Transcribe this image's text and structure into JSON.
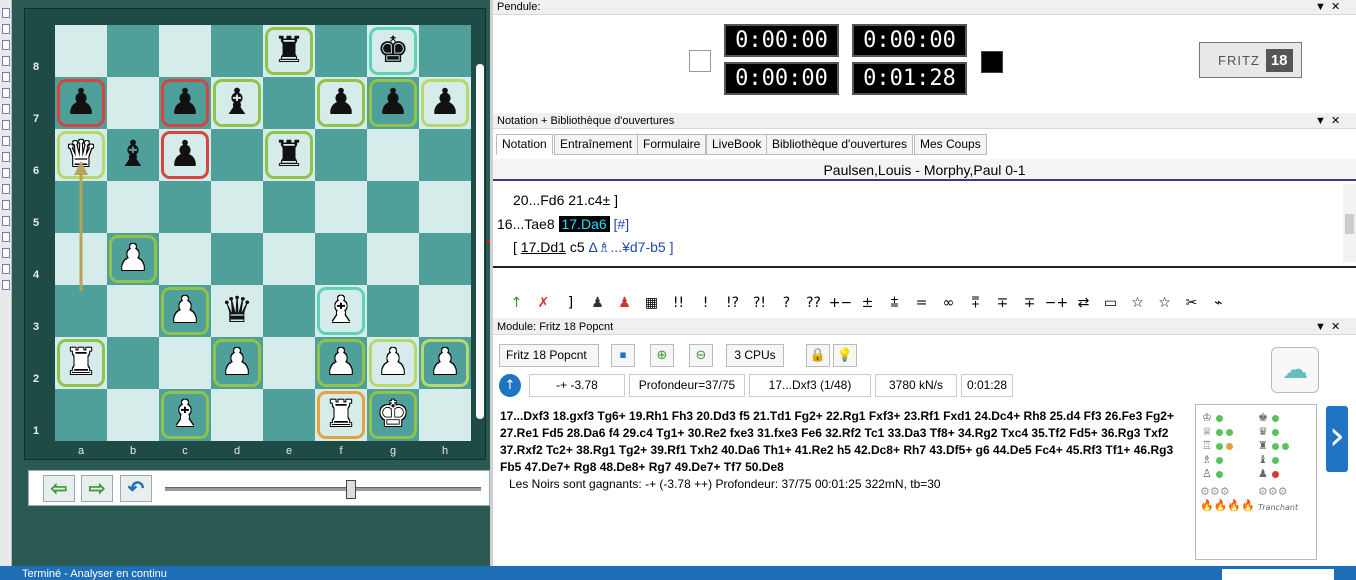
{
  "colors": {
    "light_square": "#d6ecea",
    "dark_square": "#4f9f9a",
    "status_bar": "#1e6fb6",
    "highlight_move": "#20e0ff"
  },
  "board": {
    "files": [
      "a",
      "b",
      "c",
      "d",
      "e",
      "f",
      "g",
      "h"
    ],
    "ranks": [
      "8",
      "7",
      "6",
      "5",
      "4",
      "3",
      "2",
      "1"
    ],
    "last_move": {
      "from": "a3",
      "to": "a6"
    },
    "pieces": [
      {
        "square": "e8",
        "type": "rook",
        "color": "black",
        "glyph": "♜",
        "ring": "green"
      },
      {
        "square": "g8",
        "type": "king",
        "color": "black",
        "glyph": "♚",
        "ring": "teal"
      },
      {
        "square": "a7",
        "type": "pawn",
        "color": "black",
        "glyph": "♟",
        "ring": "red"
      },
      {
        "square": "c7",
        "type": "pawn",
        "color": "black",
        "glyph": "♟",
        "ring": "red"
      },
      {
        "square": "d7",
        "type": "bishop",
        "color": "black",
        "glyph": "♝",
        "ring": "green"
      },
      {
        "square": "f7",
        "type": "pawn",
        "color": "black",
        "glyph": "♟",
        "ring": "green"
      },
      {
        "square": "g7",
        "type": "pawn",
        "color": "black",
        "glyph": "♟",
        "ring": "green"
      },
      {
        "square": "h7",
        "type": "pawn",
        "color": "black",
        "glyph": "♟",
        "ring": "lime"
      },
      {
        "square": "a6",
        "type": "queen",
        "color": "white",
        "glyph": "♛",
        "ring": "lime"
      },
      {
        "square": "b6",
        "type": "bishop",
        "color": "black",
        "glyph": "♝",
        "ring": "none"
      },
      {
        "square": "c6",
        "type": "pawn",
        "color": "black",
        "glyph": "♟",
        "ring": "red"
      },
      {
        "square": "e6",
        "type": "rook",
        "color": "black",
        "glyph": "♜",
        "ring": "green"
      },
      {
        "square": "b4",
        "type": "pawn",
        "color": "white",
        "glyph": "♟",
        "ring": "green"
      },
      {
        "square": "c3",
        "type": "pawn",
        "color": "white",
        "glyph": "♟",
        "ring": "green"
      },
      {
        "square": "d3",
        "type": "queen",
        "color": "black",
        "glyph": "♛",
        "ring": "none"
      },
      {
        "square": "f3",
        "type": "bishop",
        "color": "white",
        "glyph": "♝",
        "ring": "teal"
      },
      {
        "square": "a2",
        "type": "rook",
        "color": "white",
        "glyph": "♜",
        "ring": "green"
      },
      {
        "square": "d2",
        "type": "pawn",
        "color": "white",
        "glyph": "♟",
        "ring": "green"
      },
      {
        "square": "f2",
        "type": "pawn",
        "color": "white",
        "glyph": "♟",
        "ring": "green"
      },
      {
        "square": "g2",
        "type": "pawn",
        "color": "white",
        "glyph": "♟",
        "ring": "lime"
      },
      {
        "square": "h2",
        "type": "pawn",
        "color": "white",
        "glyph": "♟",
        "ring": "lime"
      },
      {
        "square": "c1",
        "type": "bishop",
        "color": "white",
        "glyph": "♝",
        "ring": "green"
      },
      {
        "square": "f1",
        "type": "rook",
        "color": "white",
        "glyph": "♜",
        "ring": "orange"
      },
      {
        "square": "g1",
        "type": "king",
        "color": "white",
        "glyph": "♚",
        "ring": "green"
      }
    ]
  },
  "nav": {
    "back_icon": "arrow-left-icon",
    "forward_icon": "arrow-right-icon",
    "undo_icon": "undo-icon",
    "position_fraction": 0.59
  },
  "clock": {
    "title": "Pendule:",
    "times": [
      "0:00:00",
      "0:00:00",
      "0:00:00",
      "0:01:28"
    ],
    "logo_word": "FRITZ",
    "logo_number": "18"
  },
  "notation": {
    "title": "Notation + Bibliothèque d'ouvertures",
    "tabs": [
      "Notation",
      "Entraînement",
      "Formulaire",
      "LiveBook",
      "Bibliothèque d'ouvertures",
      "Mes Coups"
    ],
    "game_header": "Paulsen,Louis - Morphy,Paul  0-1",
    "line1": "20...Fd6  21.c4± ]",
    "line2_prefix": "16...Tae8",
    "line2_current": "17.Da6",
    "line2_suffix": "[#]",
    "line3_open": "[ ",
    "line3_move": "17.Dd1",
    "line3_rest": " c5 ",
    "line3_variation": "Δ♗...¥d7-b5 ]",
    "symbols": [
      "↑",
      "✗",
      "]",
      "♟",
      "♟",
      "▦",
      "!!",
      "!",
      "!?",
      "?!",
      "?",
      "??",
      "+−",
      "±",
      "⩲",
      "=",
      "∞",
      "⩱",
      "∓",
      "∓",
      "−+",
      "⇄",
      "▭",
      "☆",
      "☆",
      "✂",
      "⌁"
    ]
  },
  "engine": {
    "title": "Module: Fritz 18 Popcnt",
    "name": "Fritz 18 Popcnt",
    "cpus": "3 CPUs",
    "eval": "-+ -3.78",
    "depth": "Profondeur=37/75",
    "current_move": "17...Dxf3 (1/48)",
    "speed": "3780 kN/s",
    "time": "0:01:28",
    "pv": "17...Dxf3 18.gxf3 Tg6+ 19.Rh1 Fh3 20.Dd3 f5 21.Td1 Fg2+ 22.Rg1 Fxf3+ 23.Rf1 Fxd1 24.Dc4+ Rh8 25.d4 Ff3 26.Fe3 Fg2+ 27.Re1 Fd5 28.Da6 f4 29.c4 Tg1+ 30.Re2 fxe3 31.fxe3 Fe6 32.Rf2 Tc1 33.Da3 Tf8+ 34.Rg2 Txc4 35.Tf2 Fd5+ 36.Rg3 Txf2 37.Rxf2 Tc2+ 38.Rg1 Tg2+ 39.Rf1 Txh2 40.Da6 Th1+ 41.Re2 h5 42.Dc8+ Rh7 43.Df5+ g6 44.De5 Fc4+ 45.Rf3 Tf1+ 46.Rg3 Fb5 47.De7+ Rg8 48.De8+ Rg7 49.De7+ Tf7 50.De8",
    "summary": "Les Noirs sont gagnants: -+ (-3.78 ++)  Profondeur: 37/75   00:01:25  322mN, tb=30",
    "style_label": "Tranchant",
    "icons": {
      "cloud": "cloud-icon",
      "next": "chevron-right-icon",
      "stop": "stop-icon",
      "zoom_in": "zoom-in-icon",
      "zoom_out": "zoom-out-icon",
      "lock": "lock-icon",
      "bulb": "bulb-icon"
    }
  },
  "status": {
    "text": "Terminé - Analyser en continu"
  }
}
